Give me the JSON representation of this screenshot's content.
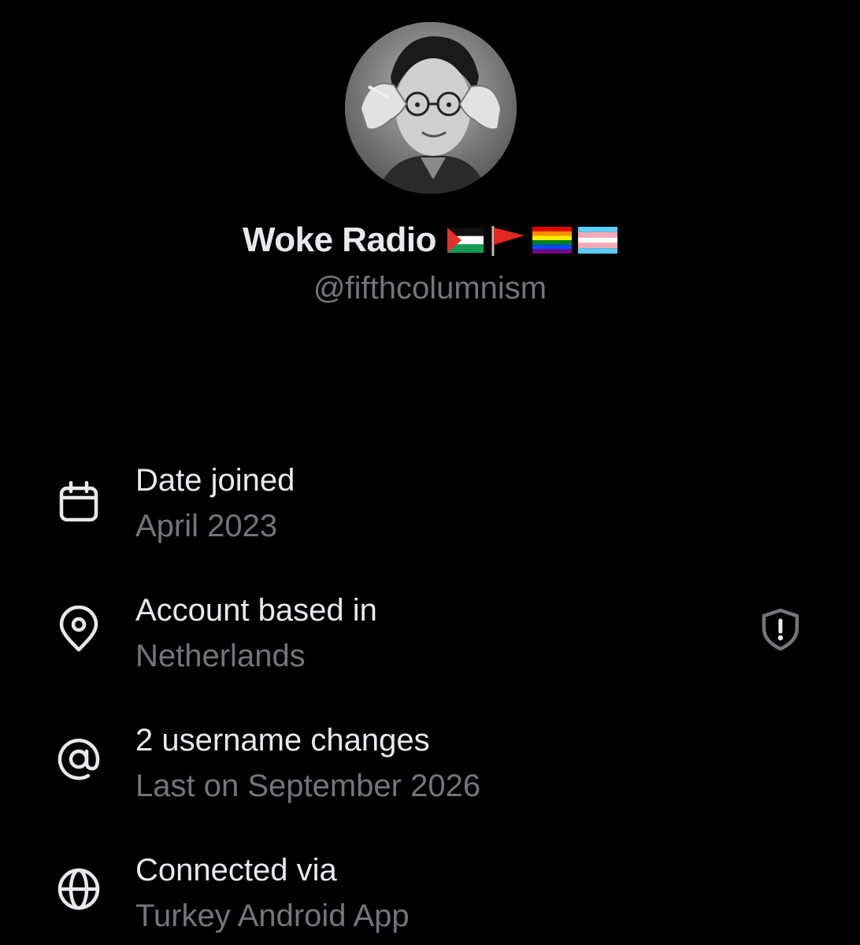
{
  "profile": {
    "display_name": "Woke Radio",
    "handle": "@fifthcolumnism",
    "flags": [
      "palestine-flag-emoji",
      "red-flag-emoji",
      "rainbow-flag-emoji",
      "transgender-flag-emoji"
    ]
  },
  "about": {
    "date_joined": {
      "icon": "calendar-icon",
      "title": "Date joined",
      "value": "April 2023"
    },
    "account_based_in": {
      "icon": "location-pin-icon",
      "title": "Account based in",
      "value": "Netherlands",
      "action_icon": "shield-alert-icon"
    },
    "username_changes": {
      "icon": "at-sign-icon",
      "title": "2 username changes",
      "value": "Last on September 2026"
    },
    "connected_via": {
      "icon": "globe-icon",
      "title": "Connected via",
      "value": "Turkey Android App"
    }
  },
  "colors": {
    "background": "#000000",
    "primary_text": "#e7e9ea",
    "secondary_text": "#71767b"
  }
}
